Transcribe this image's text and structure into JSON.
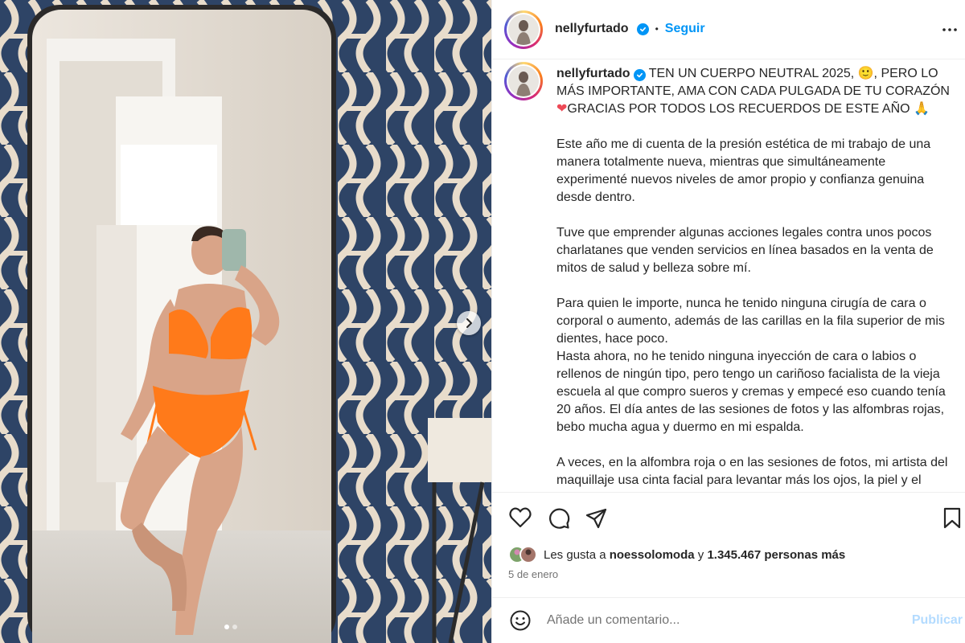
{
  "post": {
    "username": "nellyfurtado",
    "follow_label": "Seguir",
    "separator": "•",
    "media": {
      "slide_count": 2,
      "active_slide": 1
    },
    "caption": {
      "headline_1": "TEN UN CUERPO NEUTRAL 2025, 🙂, PERO LO",
      "headline_2": "MÁS IMPORTANTE, AMA CON CADA PULGADA DE TU CORAZÓN",
      "headline_3": "GRACIAS POR TODOS LOS RECUERDOS DE ESTE AÑO 🙏",
      "p1": "Este año me di cuenta de la presión estética de mi trabajo de una manera totalmente nueva, mientras que simultáneamente experimenté nuevos niveles de amor propio y confianza genuina desde dentro.",
      "p2": "Tuve que emprender algunas acciones legales contra unos pocos charlatanes que venden servicios en línea basados en la venta de mitos de salud y belleza sobre mí.",
      "p3": "Para quien le importe, nunca he tenido ninguna cirugía de cara o corporal o aumento, además de las carillas en la fila superior de mis dientes, hace poco.",
      "p4": "Hasta ahora, no he tenido ninguna inyección de cara o labios o rellenos de ningún tipo, pero tengo un cariñoso facialista de la vieja escuela al que compro sueros y cremas y empecé eso cuando tenía 20 años. El día antes de las sesiones de fotos y las alfombras rojas, bebo mucha agua y duermo en mi espalda.",
      "p5": "A veces, en la alfombra roja o en las sesiones de fotos, mi artista del maquillaje usa cinta facial para levantar más los ojos, la piel y el maquillaje. A menudo utiliza maquillaje corporal en las piernas."
    },
    "likes": {
      "prefix": "Les gusta a",
      "user": "noessolomoda",
      "conj": "y",
      "count_text": "1.345.467 personas más"
    },
    "date": "5 de enero",
    "comment": {
      "placeholder": "Añade un comentario...",
      "publish_label": "Publicar"
    }
  },
  "colors": {
    "accent": "#0095f6",
    "text": "#262626",
    "muted": "#737373",
    "publish_disabled": "#b3dbff",
    "heart_red": "#ed4956"
  }
}
